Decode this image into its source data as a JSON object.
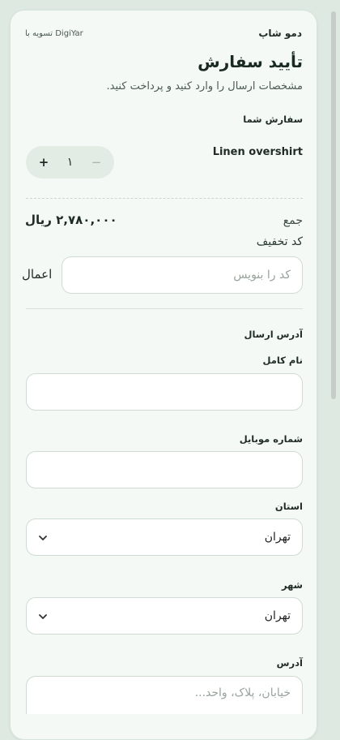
{
  "header": {
    "brand": "دمو شاپ",
    "settle_with": "تسویه با DigiYar"
  },
  "page": {
    "title": "تأیید سفارش",
    "subtitle": "مشخصات ارسال را وارد کنید و پرداخت کنید."
  },
  "order": {
    "heading": "سفارش شما",
    "item_name": "Linen overshirt",
    "quantity": "۱",
    "plus_symbol": "+",
    "minus_symbol": "−",
    "total_label": "جمع",
    "total_value": "۲,۷۸۰,۰۰۰ ریال"
  },
  "discount": {
    "label": "کد تخفیف",
    "placeholder": "کد را بنویس",
    "apply_label": "اعمال"
  },
  "shipping": {
    "heading": "آدرس ارسال",
    "full_name_label": "نام کامل",
    "full_name_value": "",
    "mobile_label": "شماره موبایل",
    "mobile_value": "",
    "province_label": "استان",
    "province_value": "تهران",
    "city_label": "شهر",
    "city_value": "تهران",
    "address_label": "آدرس",
    "address_placeholder": "خیابان، پلاک، واحد..."
  },
  "icons": {
    "select_arrow": "chevron-down-icon"
  },
  "colors": {
    "background": "#dde9e1",
    "card": "#f4f9f5",
    "text": "#1f2b24"
  }
}
